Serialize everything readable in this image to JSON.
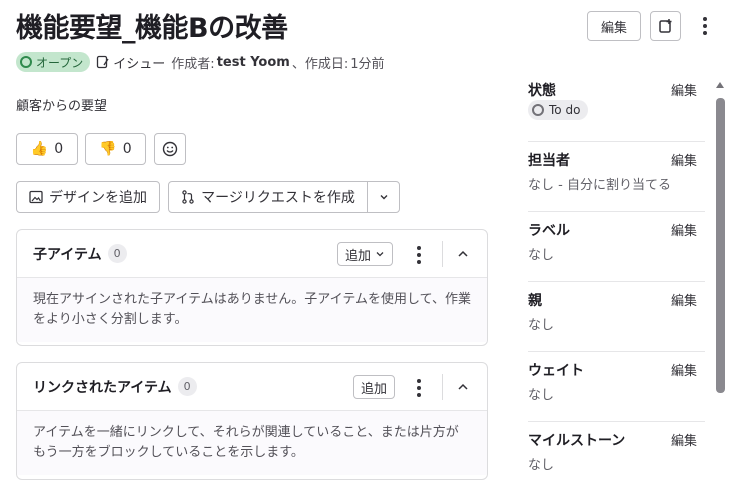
{
  "header": {
    "title": "機能要望_機能Bの改善",
    "edit_label": "編集"
  },
  "meta": {
    "status": "オープン",
    "type_label": "イシュー",
    "author_prefix": "作成者:",
    "author": "test Yoom",
    "created_prefix": "、作成日:",
    "created": "1分前"
  },
  "description": "顧客からの要望",
  "reactions": {
    "thumbs_up_count": "0",
    "thumbs_down_count": "0"
  },
  "actions": {
    "add_design": "デザインを追加",
    "create_mr": "マージリクエストを作成"
  },
  "child_items": {
    "title": "子アイテム",
    "count": "0",
    "add_label": "追加",
    "empty_text": "現在アサインされた子アイテムはありません。子アイテムを使用して、作業をより小さく分割します。"
  },
  "linked_items": {
    "title": "リンクされたアイテム",
    "count": "0",
    "add_label": "追加",
    "empty_text": "アイテムを一緒にリンクして、それらが関連していること、または片方がもう一方をブロックしていることを示します。"
  },
  "sidebar": {
    "items": [
      {
        "label": "状態",
        "edit": "編集",
        "value": "To do"
      },
      {
        "label": "担当者",
        "edit": "編集",
        "value": "なし - 自分に割り当てる"
      },
      {
        "label": "ラベル",
        "edit": "編集",
        "value": "なし"
      },
      {
        "label": "親",
        "edit": "編集",
        "value": "なし"
      },
      {
        "label": "ウェイト",
        "edit": "編集",
        "value": "なし"
      },
      {
        "label": "マイルストーン",
        "edit": "編集",
        "value": "なし"
      }
    ]
  },
  "colors": {
    "open_badge_bg": "#c3e6cd",
    "open_badge_text": "#24663b",
    "border": "#dcdcde",
    "card_body_bg": "#fbfafd"
  }
}
